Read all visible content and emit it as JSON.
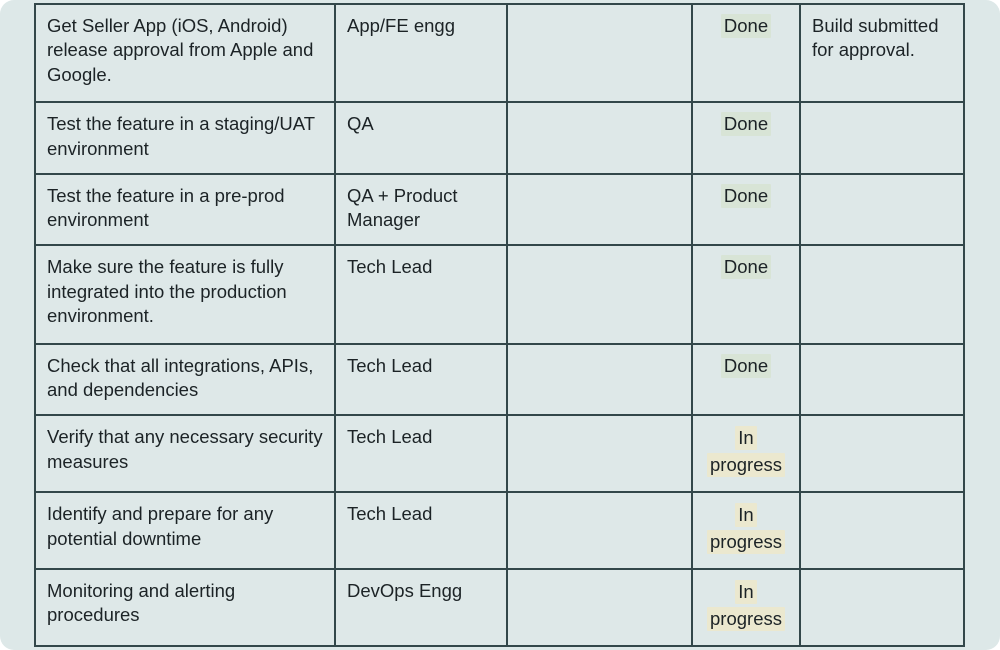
{
  "page": {
    "background_color": "#dde8e8",
    "border_color": "#33474a",
    "text_color": "#1c2326",
    "cell_fill": "#dee8e8",
    "done_highlight": "#d8e4d6",
    "inprogress_highlight": "#ebe8cf"
  },
  "table": {
    "columns": [
      "task",
      "owner",
      "blank",
      "status",
      "notes"
    ],
    "rows": [
      {
        "task": "Get Seller App (iOS, Android) release approval from Apple and Google.",
        "owner": "App/FE engg",
        "blank": "",
        "status": "Done",
        "status_type": "done",
        "notes": "Build submitted for approval."
      },
      {
        "task": "Test the feature in a staging/UAT environment",
        "owner": "QA",
        "blank": "",
        "status": "Done",
        "status_type": "done",
        "notes": ""
      },
      {
        "task": "Test the feature in a pre-prod environment",
        "owner": "QA + Product Manager",
        "blank": "",
        "status": "Done",
        "status_type": "done",
        "notes": ""
      },
      {
        "task": "Make sure the feature is fully integrated into the production environment.",
        "owner": "Tech Lead",
        "blank": "",
        "status": "Done",
        "status_type": "done",
        "notes": ""
      },
      {
        "task": "Check that all integrations, APIs, and dependencies",
        "owner": "Tech Lead",
        "blank": "",
        "status": "Done",
        "status_type": "done",
        "notes": ""
      },
      {
        "task": "Verify that any necessary security measures",
        "owner": "Tech Lead",
        "blank": "",
        "status": "In progress",
        "status_type": "inprogress",
        "notes": ""
      },
      {
        "task": "Identify and prepare for any potential downtime",
        "owner": "Tech Lead",
        "blank": "",
        "status": "In progress",
        "status_type": "inprogress",
        "notes": ""
      },
      {
        "task": "Monitoring and alerting procedures",
        "owner": "DevOps Engg",
        "blank": "",
        "status": "In progress",
        "status_type": "inprogress",
        "notes": ""
      }
    ]
  }
}
